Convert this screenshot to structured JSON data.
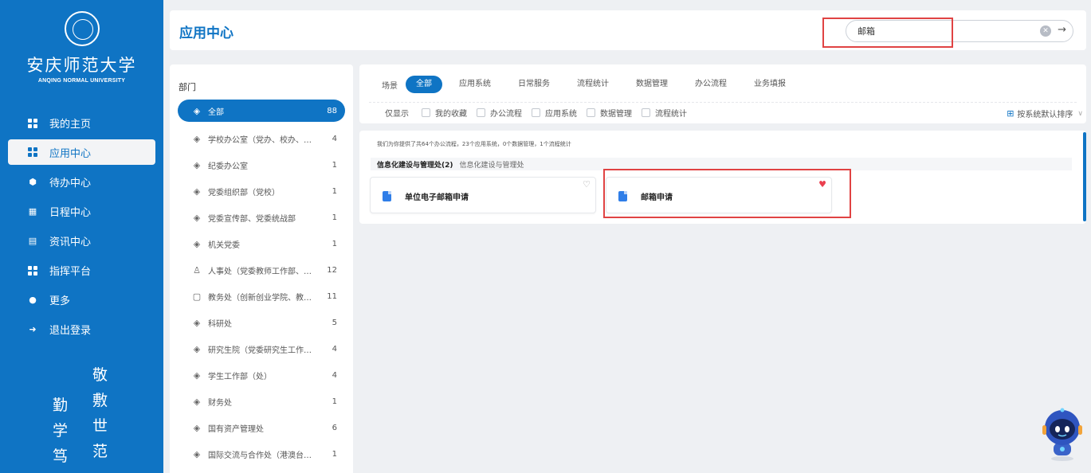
{
  "sidebar": {
    "logo_cn": "安庆师范大学",
    "logo_en": "ANQING NORMAL UNIVERSITY",
    "items": [
      {
        "label": "我的主页",
        "icon": "grid-icon"
      },
      {
        "label": "应用中心",
        "icon": "grid-icon",
        "active": true
      },
      {
        "label": "待办中心",
        "icon": "shield-icon"
      },
      {
        "label": "日程中心",
        "icon": "calendar-icon"
      },
      {
        "label": "资讯中心",
        "icon": "news-icon"
      },
      {
        "label": "指挥平台",
        "icon": "grid-icon"
      },
      {
        "label": "更多",
        "icon": "home-icon"
      },
      {
        "label": "退出登录",
        "icon": "logout-icon"
      }
    ],
    "motto": [
      "敬",
      "敷",
      "勤",
      "学",
      "世",
      "笃",
      "范"
    ]
  },
  "header": {
    "title": "应用中心",
    "search_value": "邮箱",
    "clear_icon": "clear-icon",
    "go_icon": "arrow-right-icon"
  },
  "dept": {
    "title": "部门",
    "items": [
      {
        "label": "全部",
        "count": "88",
        "icon": "layers-icon",
        "active": true
      },
      {
        "label": "学校办公室（党办、校办、…",
        "count": "4",
        "icon": "layers-icon"
      },
      {
        "label": "纪委办公室",
        "count": "1",
        "icon": "layers-icon"
      },
      {
        "label": "党委组织部（党校）",
        "count": "1",
        "icon": "layers-icon"
      },
      {
        "label": "党委宣传部、党委统战部",
        "count": "1",
        "icon": "layers-icon"
      },
      {
        "label": "机关党委",
        "count": "1",
        "icon": "layers-icon"
      },
      {
        "label": "人事处（党委教师工作部、…",
        "count": "12",
        "icon": "user-icon"
      },
      {
        "label": "教务处（创新创业学院、教…",
        "count": "11",
        "icon": "book-icon"
      },
      {
        "label": "科研处",
        "count": "5",
        "icon": "layers-icon"
      },
      {
        "label": "研究生院（党委研究生工作…",
        "count": "4",
        "icon": "layers-icon"
      },
      {
        "label": "学生工作部（处）",
        "count": "4",
        "icon": "layers-icon"
      },
      {
        "label": "财务处",
        "count": "1",
        "icon": "layers-icon"
      },
      {
        "label": "国有资产管理处",
        "count": "6",
        "icon": "layers-icon"
      },
      {
        "label": "国际交流与合作处（港澳台…",
        "count": "1",
        "icon": "layers-icon"
      }
    ]
  },
  "filters": {
    "scene_label": "场景",
    "scenes": [
      "全部",
      "应用系统",
      "日常服务",
      "流程统计",
      "数据管理",
      "办公流程",
      "业务填报"
    ],
    "only_label": "仅显示",
    "checkboxes": [
      "我的收藏",
      "办公流程",
      "应用系统",
      "数据管理",
      "流程统计"
    ],
    "sort_label": "按系统默认排序"
  },
  "results": {
    "summary": "我们为你提供了共64个办公流程，23个应用系统，0个数据管理，1个流程统计",
    "group_name": "信息化建设与管理处(2)",
    "group_sub": "信息化建设与管理处",
    "cards": [
      {
        "name": "单位电子邮箱申请",
        "favorite": false
      },
      {
        "name": "邮箱申请",
        "favorite": true
      }
    ]
  },
  "colors": {
    "primary": "#0f74c4",
    "highlight_box": "#e04343",
    "favorite": "#ea3f4f",
    "background": "#eef0f3"
  }
}
